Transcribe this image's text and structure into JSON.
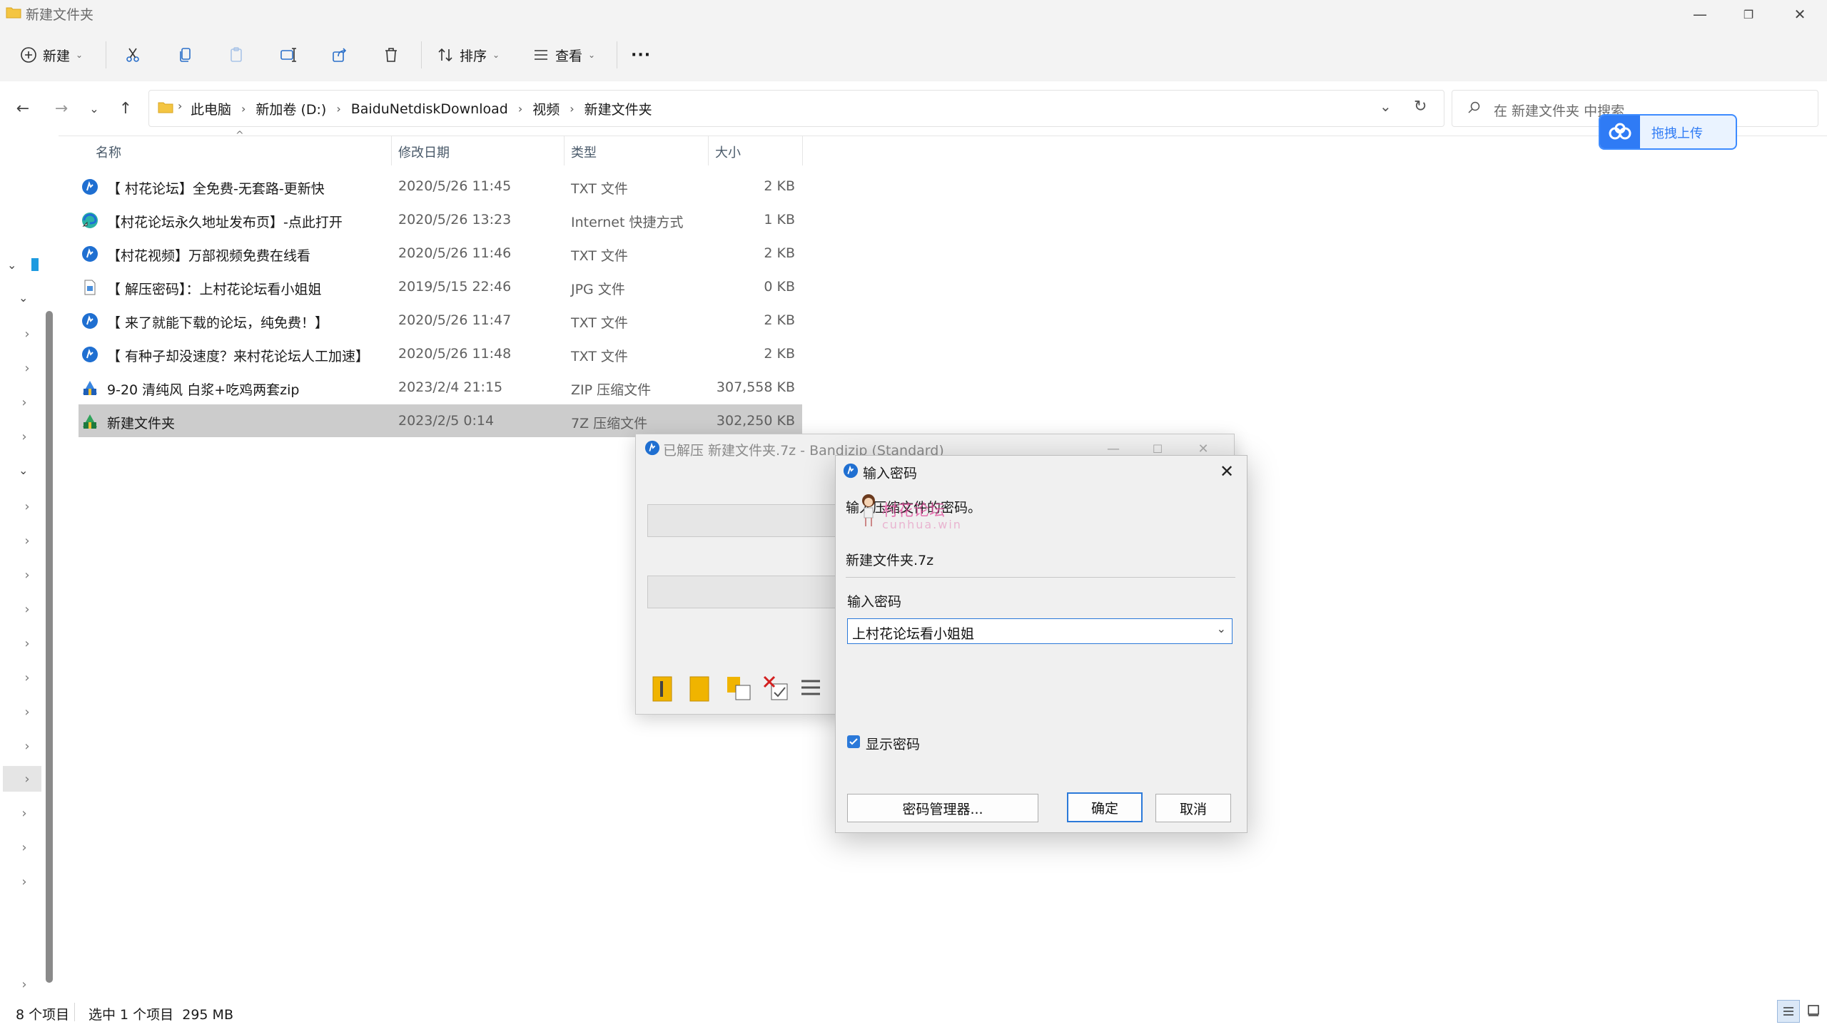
{
  "window": {
    "title": "新建文件夹",
    "minimize": "—",
    "maximize": "❐",
    "close": "✕"
  },
  "toolbar": {
    "new_label": "新建",
    "sort_label": "排序",
    "view_label": "查看",
    "more_label": "···"
  },
  "address": {
    "crumbs": [
      "此电脑",
      "新加卷 (D:)",
      "BaiduNetdiskDownload",
      "视频",
      "新建文件夹"
    ],
    "search_placeholder": "在 新建文件夹 中搜索"
  },
  "baidu_widget": {
    "label": "拖拽上传"
  },
  "columns": {
    "name": "名称",
    "date": "修改日期",
    "type": "类型",
    "size": "大小"
  },
  "files": [
    {
      "name": "【 村花论坛】全免费-无套路-更新快",
      "date": "2020/5/26 11:45",
      "type": "TXT 文件",
      "size": "2 KB",
      "icon": "bandizip-txt-icon"
    },
    {
      "name": "【村花论坛永久地址发布页】-点此打开",
      "date": "2020/5/26 13:23",
      "type": "Internet 快捷方式",
      "size": "1 KB",
      "icon": "internet-shortcut-icon"
    },
    {
      "name": "【村花视频】万部视频免费在线看",
      "date": "2020/5/26 11:46",
      "type": "TXT 文件",
      "size": "2 KB",
      "icon": "bandizip-txt-icon"
    },
    {
      "name": "【 解压密码】：上村花论坛看小姐姐",
      "date": "2019/5/15 22:46",
      "type": "JPG 文件",
      "size": "0 KB",
      "icon": "jpg-file-icon"
    },
    {
      "name": "【 来了就能下载的论坛，纯免费！】",
      "date": "2020/5/26 11:47",
      "type": "TXT 文件",
      "size": "2 KB",
      "icon": "bandizip-txt-icon"
    },
    {
      "name": "【 有种子却没速度？来村花论坛人工加速】",
      "date": "2020/5/26 11:48",
      "type": "TXT 文件",
      "size": "2 KB",
      "icon": "bandizip-txt-icon"
    },
    {
      "name": "9-20 清纯风 白浆+吃鸡两套zip",
      "date": "2023/2/4 21:15",
      "type": "ZIP 压缩文件",
      "size": "307,558 KB",
      "icon": "zip-archive-icon"
    },
    {
      "name": "新建文件夹",
      "date": "2023/2/5 0:14",
      "type": "7Z 压缩文件",
      "size": "302,250 KB",
      "icon": "7z-archive-icon"
    }
  ],
  "status": {
    "count": "8 个项目",
    "selection": "选中 1 个项目  295 MB"
  },
  "bandizip": {
    "title": "已解压 新建文件夹.7z - Bandizip (Standard)"
  },
  "password_dialog": {
    "title": "输入密码",
    "message": "输入压缩文件的密码。",
    "filename": "新建文件夹.7z",
    "field_label": "输入密码",
    "password_value": "上村花论坛看小姐姐",
    "show_password_label": "显示密码",
    "manager_button": "密码管理器...",
    "ok_button": "确定",
    "cancel_button": "取消"
  },
  "watermark": {
    "text": "村花论坛",
    "subtext": "cunhua.win"
  },
  "colors": {
    "accent": "#2b79d9",
    "selection": "#cccccc",
    "baidu_blue": "#2f7bf5"
  }
}
